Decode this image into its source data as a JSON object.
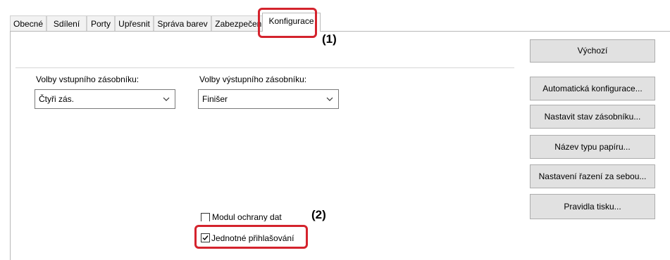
{
  "tabs": [
    {
      "label": "Obecné"
    },
    {
      "label": "Sdílení"
    },
    {
      "label": "Porty"
    },
    {
      "label": "Upřesnit"
    },
    {
      "label": "Správa barev"
    },
    {
      "label": "Zabezpečení"
    },
    {
      "label": "Konfigurace",
      "active": true
    }
  ],
  "callouts": {
    "one": "(1)",
    "two": "(2)"
  },
  "input_tray": {
    "label": "Volby vstupního zásobníku:",
    "value": "Čtyři zás."
  },
  "output_tray": {
    "label": "Volby výstupního zásobníku:",
    "value": "Finišer"
  },
  "buttons": {
    "default": "Výchozí",
    "auto_config": "Automatická konfigurace...",
    "tray_status": "Nastavit stav zásobníku...",
    "paper_type": "Název typu papíru...",
    "sequential": "Nastavení řazení za sebou...",
    "print_rules": "Pravidla tisku..."
  },
  "checkboxes": {
    "data_security": {
      "label": "Modul ochrany dat",
      "checked": false
    },
    "sso": {
      "label": "Jednotné přihlašování",
      "checked": true
    }
  },
  "colors": {
    "accent_red": "#d4232d",
    "button_bg": "#e1e1e1",
    "border": "#adadad"
  }
}
